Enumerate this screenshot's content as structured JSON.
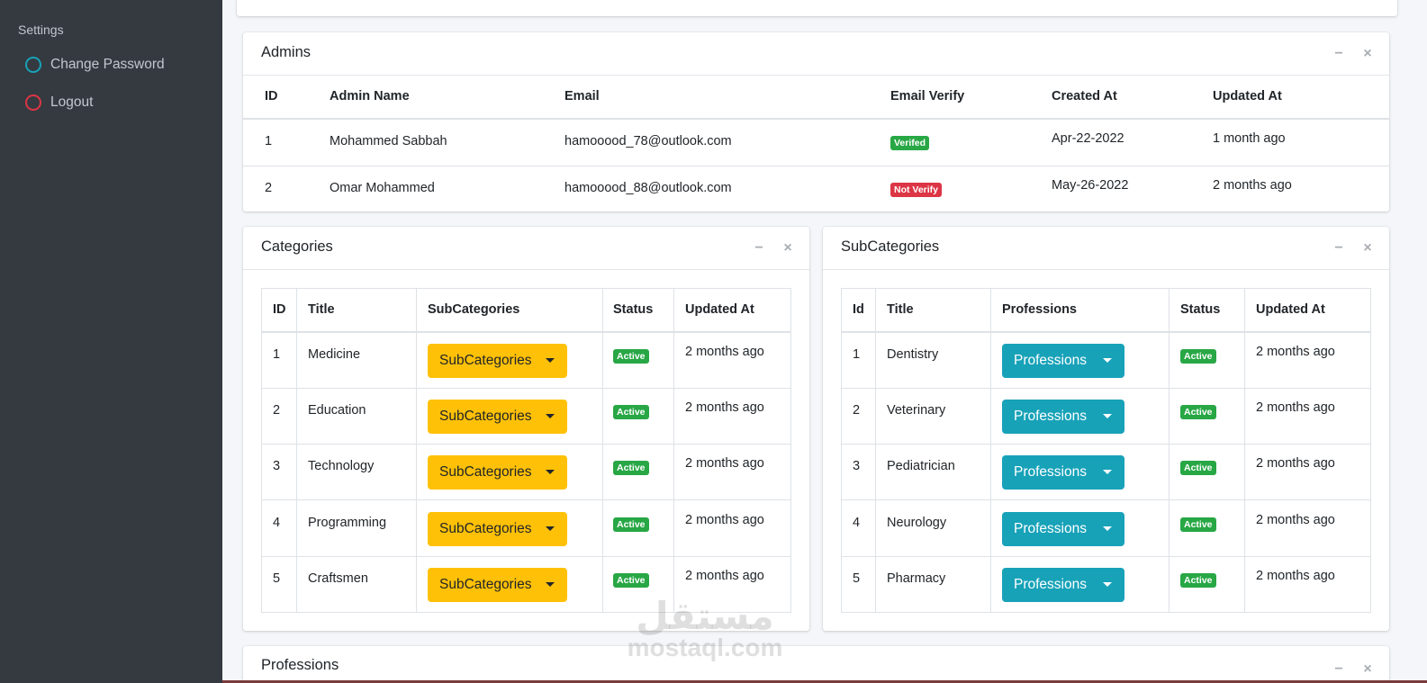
{
  "sidebar": {
    "header": "Settings",
    "items": [
      {
        "label": "Change Password",
        "icon": "circle-outline-teal-icon"
      },
      {
        "label": "Logout",
        "icon": "circle-outline-red-icon"
      }
    ]
  },
  "admins": {
    "title": "Admins",
    "columns": [
      "ID",
      "Admin Name",
      "Email",
      "Email Verify",
      "Created At",
      "Updated At"
    ],
    "rows": [
      {
        "id": "1",
        "name": "Mohammed Sabbah",
        "email": "hamooood_78@outlook.com",
        "verify": "Verifed",
        "created": "Apr-22-2022",
        "updated": "1 month ago"
      },
      {
        "id": "2",
        "name": "Omar Mohammed",
        "email": "hamooood_88@outlook.com",
        "verify": "Not Verify",
        "created": "May-26-2022",
        "updated": "2 months ago"
      }
    ]
  },
  "categories": {
    "title": "Categories",
    "columns": [
      "ID",
      "Title",
      "SubCategories",
      "Status",
      "Updated At"
    ],
    "button_label": "SubCategories",
    "rows": [
      {
        "id": "1",
        "title": "Medicine",
        "status": "Active",
        "updated": "2 months ago"
      },
      {
        "id": "2",
        "title": "Education",
        "status": "Active",
        "updated": "2 months ago"
      },
      {
        "id": "3",
        "title": "Technology",
        "status": "Active",
        "updated": "2 months ago"
      },
      {
        "id": "4",
        "title": "Programming",
        "status": "Active",
        "updated": "2 months ago"
      },
      {
        "id": "5",
        "title": "Craftsmen",
        "status": "Active",
        "updated": "2 months ago"
      }
    ]
  },
  "subcategories": {
    "title": "SubCategories",
    "columns": [
      "Id",
      "Title",
      "Professions",
      "Status",
      "Updated At"
    ],
    "button_label": "Professions",
    "rows": [
      {
        "id": "1",
        "title": "Dentistry",
        "status": "Active",
        "updated": "2 months ago"
      },
      {
        "id": "2",
        "title": "Veterinary",
        "status": "Active",
        "updated": "2 months ago"
      },
      {
        "id": "3",
        "title": "Pediatrician",
        "status": "Active",
        "updated": "2 months ago"
      },
      {
        "id": "4",
        "title": "Neurology",
        "status": "Active",
        "updated": "2 months ago"
      },
      {
        "id": "5",
        "title": "Pharmacy",
        "status": "Active",
        "updated": "2 months ago"
      }
    ]
  },
  "professions": {
    "title": "Professions"
  },
  "card_tools": {
    "minimize": "−",
    "close": "×"
  },
  "watermark": {
    "arabic": "مستقل",
    "latin": "mostaql.com"
  },
  "colors": {
    "sidebar_bg": "#343a40",
    "success": "#28a745",
    "danger": "#dc3545",
    "warning": "#ffc107",
    "info": "#17a2b8"
  }
}
